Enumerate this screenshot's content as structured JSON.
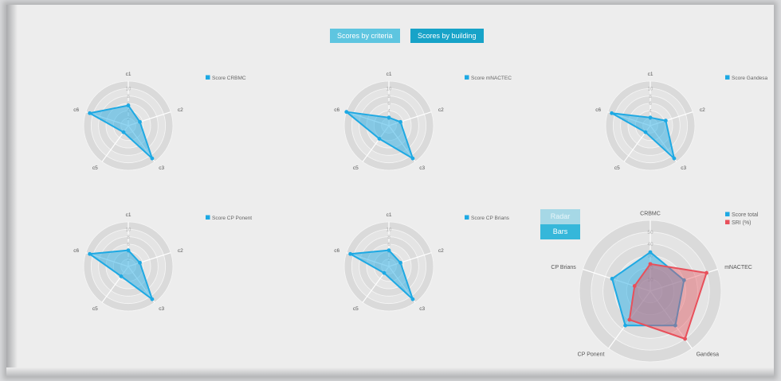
{
  "tabs": {
    "criteria_label": "Scores by criteria",
    "building_label": "Scores by building"
  },
  "toggle": {
    "radar_label": "Radar",
    "bars_label": "Bars"
  },
  "colors": {
    "series_blue": "#1ea9e3",
    "series_red": "#e8505b"
  },
  "chart_data": [
    {
      "type": "radar",
      "categories": [
        "c1",
        "c2",
        "c3",
        "c5",
        "c6"
      ],
      "ticks": [
        "2",
        "4",
        "6",
        "8",
        "10"
      ],
      "rmax": 11,
      "series": [
        {
          "name": "Score CRBMC",
          "values": [
            5,
            3,
            10,
            2,
            10
          ]
        }
      ]
    },
    {
      "type": "radar",
      "categories": [
        "c1",
        "c2",
        "c3",
        "c5",
        "c6"
      ],
      "ticks": [
        "2",
        "4",
        "6",
        "8",
        "10"
      ],
      "rmax": 11,
      "series": [
        {
          "name": "Score mNACTEC",
          "values": [
            2,
            3,
            10,
            4,
            11
          ]
        }
      ]
    },
    {
      "type": "radar",
      "categories": [
        "c1",
        "c2",
        "c3",
        "c5",
        "c6"
      ],
      "ticks": [
        "2",
        "4",
        "6",
        "8",
        "10"
      ],
      "rmax": 11,
      "series": [
        {
          "name": "Score Gandesa",
          "values": [
            2,
            4,
            10,
            2,
            10
          ]
        }
      ]
    },
    {
      "type": "radar",
      "categories": [
        "c1",
        "c2",
        "c3",
        "c5",
        "c6"
      ],
      "ticks": [
        "2",
        "4",
        "6",
        "8",
        "10"
      ],
      "rmax": 11,
      "series": [
        {
          "name": "Score CP Ponent",
          "values": [
            4,
            3,
            10,
            3,
            10
          ]
        }
      ]
    },
    {
      "type": "radar",
      "categories": [
        "c1",
        "c2",
        "c3",
        "c5",
        "c6"
      ],
      "ticks": [
        "2",
        "4",
        "6",
        "8",
        "10"
      ],
      "rmax": 11,
      "series": [
        {
          "name": "Score CP Brians",
          "values": [
            4,
            3,
            10,
            2,
            10
          ]
        }
      ]
    },
    {
      "type": "radar",
      "categories": [
        "CRBMC",
        "mNACTEC",
        "Gandesa",
        "CP Ponent",
        "CP Brians"
      ],
      "ticks": [
        "10",
        "20",
        "30",
        "40",
        "50"
      ],
      "rmax": 60,
      "series": [
        {
          "name": "Score total",
          "values": [
            33,
            30,
            36,
            36,
            34
          ]
        },
        {
          "name": "SRI (%)",
          "values": [
            23,
            50,
            50,
            30,
            14
          ]
        }
      ]
    }
  ]
}
